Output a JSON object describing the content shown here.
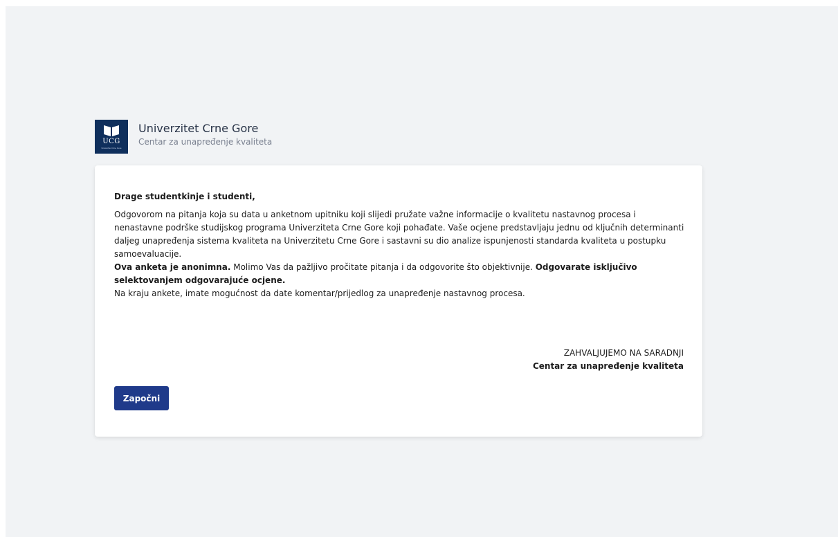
{
  "header": {
    "logo_text": "UCG",
    "logo_subtext": "Univerzitet Crne Gore",
    "title": "Univerzitet Crne Gore",
    "subtitle": "Centar za unapređenje kvaliteta"
  },
  "intro": {
    "greeting": "Drage studentkinje i studenti,",
    "paragraph1": "Odgovorom na pitanja koja su data u anketnom upitniku koji slijedi pružate važne informacije o kvalitetu nastavnog procesa i nenastavne podrške studijskog programa Univerziteta Crne Gore koji pohađate. Vaše ocjene predstavljaju jednu od ključnih determinanti daljeg unapređenja sistema kvaliteta na Univerzitetu Crne Gore i sastavni su dio analize ispunjenosti standarda kvaliteta u postupku samoevaluacije.",
    "anonymous_bold": "Ova anketa je anonimna.",
    "anonymous_text": " Molimo Vas da pažljivo pročitate pitanja i da odgovorite što objektivnije. ",
    "answer_bold": "Odgovarate isključivo selektovanjem odgovarajuće ocjene.",
    "paragraph3": "Na kraju ankete, imate mogućnost da date komentar/prijedlog za unapređenje nastavnog procesa."
  },
  "signature": {
    "thanks": "ZAHVALJUJEMO NA SARADNJI",
    "org": "Centar za unapređenje kvaliteta"
  },
  "actions": {
    "start_label": "Započni"
  },
  "colors": {
    "page_background": "#f1f3f5",
    "brand_navy": "#0f2f5c",
    "button": "#1f3a8a"
  },
  "icons": {
    "logo": "open-book-icon"
  }
}
